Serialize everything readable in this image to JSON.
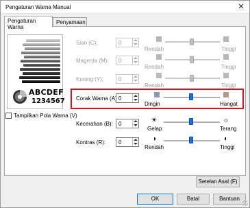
{
  "window": {
    "title": "Pengaturan Warna Manual",
    "close_glyph": "✕"
  },
  "tabs": [
    {
      "label": "Pengaturan Warna",
      "active": true
    },
    {
      "label": "Penyamaan",
      "active": false
    }
  ],
  "preview": {
    "sample_text": "ABCDEF",
    "sample_number": "1234567",
    "show_pattern_label": "Tampilkan Pola Warna (V)",
    "show_pattern_checked": false
  },
  "cyan": {
    "label": "Sian (C):",
    "value": "0",
    "low_label": "Rendah",
    "high_label": "Tinggi",
    "enabled": false,
    "swatch_color": "#b8b8b8"
  },
  "magenta": {
    "label": "Magenta (M):",
    "value": "0",
    "low_label": "Rendah",
    "high_label": "Tinggi",
    "enabled": false,
    "swatch_color": "#b8b8b8"
  },
  "yellow": {
    "label": "Kuning (Y):",
    "value": "0",
    "low_label": "Rendah",
    "high_label": "Tinggi",
    "enabled": false,
    "swatch_color": "#b8b8b8"
  },
  "tone": {
    "label": "Corak Warna (A):",
    "value": "0",
    "low_label": "Dingin",
    "high_label": "Hangat",
    "enabled": true,
    "low_color": "#8a9ab0",
    "high_color": "#b09a86"
  },
  "brightness": {
    "label": "Kecerahan (B):",
    "value": "0",
    "low_label": "Gelap",
    "high_label": "Terang",
    "enabled": true,
    "low_icon": "sun-dark-icon",
    "high_icon": "sun-bright-icon"
  },
  "contrast": {
    "label": "Kontras (R):",
    "value": "0",
    "low_label": "Rendah",
    "high_label": "Tinggi",
    "enabled": true,
    "low_icon": "contrast-low-icon",
    "high_icon": "contrast-high-icon"
  },
  "buttons": {
    "defaults": "Setelan Asal (F)",
    "ok": "OK",
    "cancel": "Batal",
    "help": "Bantuan"
  },
  "colors": {
    "highlight_border": "#e0101a",
    "slider_thumb": "#1e6fd6",
    "focus_border": "#0078d7"
  }
}
